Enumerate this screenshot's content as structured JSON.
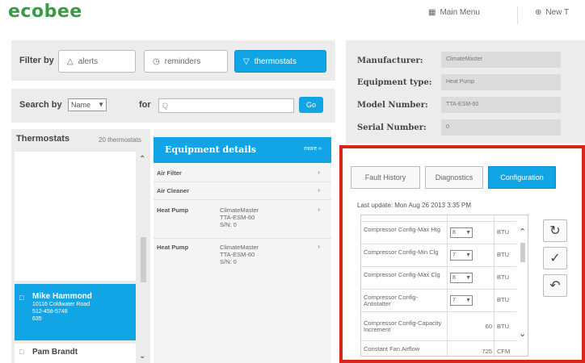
{
  "header": {
    "logo": "ecobee",
    "main_menu_label": "Main Menu",
    "new_label": "New T"
  },
  "filter": {
    "label": "Filter by",
    "buttons": [
      "alerts",
      "reminders",
      "thermostats"
    ],
    "active": "thermostats"
  },
  "search": {
    "label": "Search by",
    "select_value": "Name",
    "for_label": "for",
    "input_placeholder": "Q",
    "go_label": "Go"
  },
  "thermostats": {
    "title": "Thermostats",
    "count_label": "20 thermostats",
    "selected": {
      "name": "Mike Hammond",
      "lines": [
        "10116 Coldwater Road",
        "512-458-5748",
        "635"
      ]
    },
    "next_name": "Pam Brandt"
  },
  "equipment": {
    "title": "Equipment details",
    "more_label": "more »",
    "rows": [
      {
        "name": "Air Filter",
        "lines": []
      },
      {
        "name": "Air Cleaner",
        "lines": []
      },
      {
        "name": "Heat Pump",
        "lines": [
          "ClimateMaster",
          "TTA-ESM-60",
          "S/N: 0"
        ]
      },
      {
        "name": "Heat Pump",
        "lines": [
          "ClimateMaster",
          "TTA-ESM-60",
          "S/N: 0"
        ]
      }
    ]
  },
  "details": {
    "manufacturer_label": "Manufacturer:",
    "manufacturer_value": "ClimateMaster",
    "equipment_type_label": "Equipment type:",
    "equipment_type_value": "Heat Pump",
    "model_label": "Model Number:",
    "model_value": "TTA-ESM-60",
    "serial_label": "Serial Number:",
    "serial_value": "0"
  },
  "config": {
    "tabs": [
      "Fault History",
      "Diagnostics",
      "Configuration"
    ],
    "active_tab": "Configuration",
    "last_update": "Last update: Mon Aug 26 2013 3:35 PM",
    "rows": [
      {
        "label": "Compressor Config-Max Htg",
        "select": "8",
        "value": "",
        "unit": "BTU"
      },
      {
        "label": "Compressor Config-Min Clg",
        "select": "7",
        "value": "",
        "unit": "BTU"
      },
      {
        "label": "Compressor Config-Max Clg",
        "select": "8",
        "value": "",
        "unit": "BTU"
      },
      {
        "label": "Compressor Config-Antistatter",
        "select": "7",
        "value": "",
        "unit": "BTU"
      },
      {
        "label": "Compressor Config-Capacity Increment",
        "select": "",
        "value": "60",
        "unit": "BTU"
      },
      {
        "label": "Constant Fan Airflow",
        "select": "",
        "value": "725",
        "unit": "CFM"
      }
    ],
    "actions": [
      "refresh",
      "apply",
      "undo"
    ]
  },
  "colors": {
    "brand_green": "#3a9a45",
    "accent_blue": "#12a5e5",
    "highlight_red": "#d8261c"
  }
}
